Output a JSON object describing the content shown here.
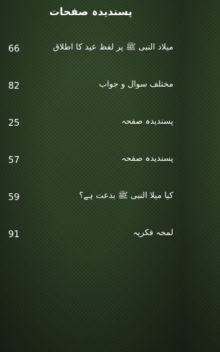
{
  "header": {
    "title": "پسندیدہ صفحات"
  },
  "favorites": [
    {
      "title": "میلاد النبی ﷺ پر لفظ عید کا اطلاق",
      "page": "66"
    },
    {
      "title": "مختلف سوال و جواب",
      "page": "82"
    },
    {
      "title": "پسندیدہ صفحہ",
      "page": "25"
    },
    {
      "title": "پسندیدہ صفحہ",
      "page": "57"
    },
    {
      "title": "کیا میلا النبی ﷺ بدعت ہے؟",
      "page": "59"
    },
    {
      "title": "لمحہ فکریہ",
      "page": "91"
    }
  ],
  "colors": {
    "background": "#2f4228",
    "text": "#ffffff"
  }
}
